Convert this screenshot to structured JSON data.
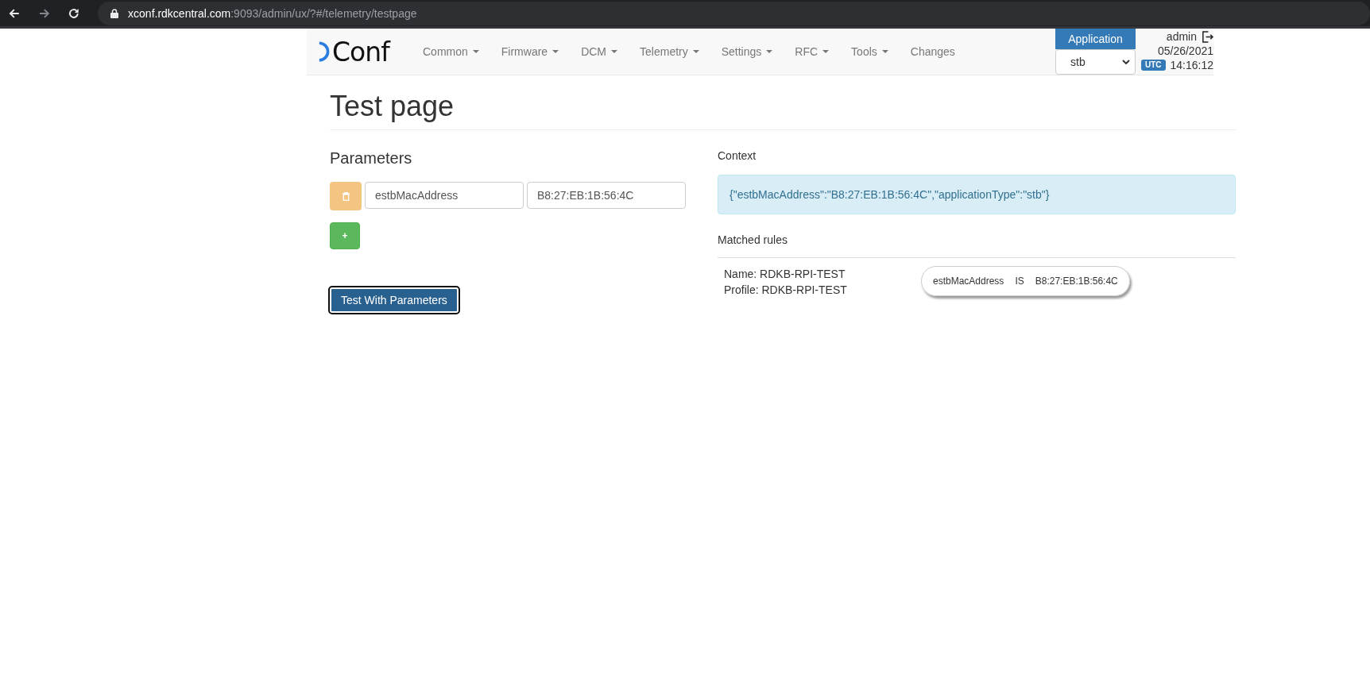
{
  "browser": {
    "url_host": "xconf.rdkcentral.com",
    "url_path": ":9093/admin/ux/?#/telemetry/testpage"
  },
  "navbar": {
    "logo": "Conf",
    "items": [
      {
        "label": "Common",
        "dropdown": true
      },
      {
        "label": "Firmware",
        "dropdown": true
      },
      {
        "label": "DCM",
        "dropdown": true
      },
      {
        "label": "Telemetry",
        "dropdown": true
      },
      {
        "label": "Settings",
        "dropdown": true
      },
      {
        "label": "RFC",
        "dropdown": true
      },
      {
        "label": "Tools",
        "dropdown": true
      },
      {
        "label": "Changes",
        "dropdown": false
      }
    ],
    "application": {
      "label": "Application",
      "value": "stb"
    },
    "user": "admin",
    "date": "05/26/2021",
    "timezone": "UTC",
    "time": "14:16:12"
  },
  "page_title": "Test page",
  "parameters": {
    "heading": "Parameters",
    "rows": [
      {
        "name": "estbMacAddress",
        "value": "B8:27:EB:1B:56:4C"
      }
    ],
    "add_label": "+",
    "submit_label": "Test With Parameters"
  },
  "context": {
    "heading": "Context",
    "value": "{\"estbMacAddress\":\"B8:27:EB:1B:56:4C\",\"applicationType\":\"stb\"}"
  },
  "matched_rules": {
    "heading": "Matched rules",
    "rules": [
      {
        "name": "Name: RDKB-RPI-TEST",
        "profile": "Profile: RDKB-RPI-TEST",
        "condition": {
          "key": "estbMacAddress",
          "operator": "IS",
          "value": "B8:27:EB:1B:56:4C"
        }
      }
    ]
  }
}
